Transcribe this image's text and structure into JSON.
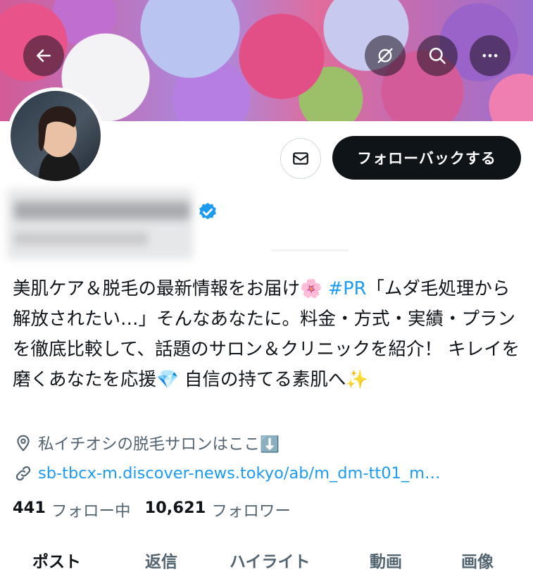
{
  "header": {
    "back_icon": "arrow-left-icon",
    "buttons": [
      "hide-icon",
      "search-icon",
      "more-icon"
    ]
  },
  "profile": {
    "mail_icon": "envelope-icon",
    "follow_back_label": "フォローバックする",
    "verified_color": "#1d9bf0",
    "bio_text": "美肌ケア＆脱毛の最新情報をお届け🌸 ",
    "bio_hashtag": "#PR",
    "bio_rest": "「ムダ毛処理から解放されたい…」そんなあなたに。料金・方式・実績・プランを徹底比較して、話題のサロン＆クリニックを紹介！ キレイを磨くあなたを応援💎 自信の持てる素肌へ✨",
    "location": "私イチオシの脱毛サロンはここ⬇️",
    "link": "sb-tbcx-m.discover-news.tokyo/ab/m_dm-tt01_m…",
    "following_count": "441",
    "following_label": "フォロー中",
    "followers_count": "10,621",
    "followers_label": "フォロワー"
  },
  "tabs": [
    "ポスト",
    "返信",
    "ハイライト",
    "動画",
    "画像"
  ],
  "colors": {
    "accent": "#1d9bf0",
    "text": "#0f1419",
    "muted": "#536471"
  }
}
